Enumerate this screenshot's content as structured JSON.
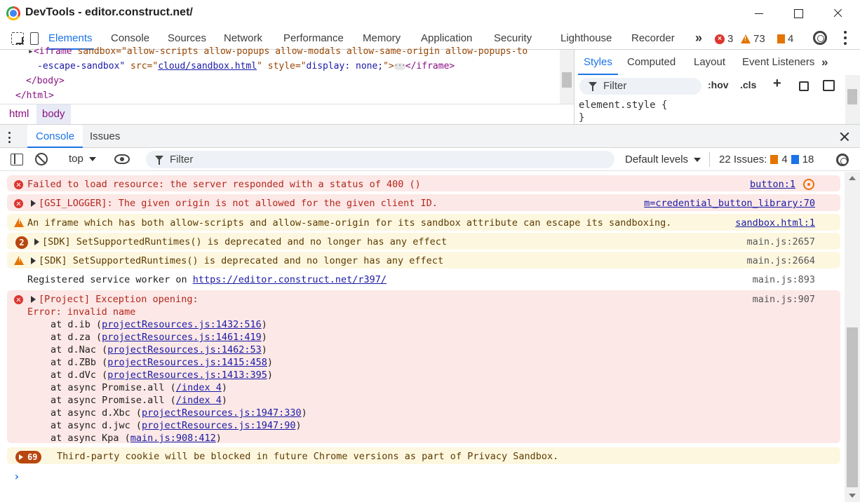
{
  "window": {
    "title": "DevTools - editor.construct.net/"
  },
  "main_tabs": [
    {
      "label": "Elements",
      "active": true
    },
    {
      "label": "Console"
    },
    {
      "label": "Sources"
    },
    {
      "label": "Network"
    },
    {
      "label": "Performance"
    },
    {
      "label": "Memory"
    },
    {
      "label": "Application"
    },
    {
      "label": "Security"
    },
    {
      "label": "Lighthouse"
    },
    {
      "label": "Recorder"
    }
  ],
  "status_counts": {
    "errors": "3",
    "warnings": "73",
    "info": "4"
  },
  "elements": {
    "line1": {
      "tag_open": "<iframe ",
      "attrs_text": "sandbox=\"allow-scripts allow-popups allow-modals allow-same-origin allow-popups-to"
    },
    "line2": {
      "part1": "-escape-sandbox\"",
      "src_attr": " src=\"",
      "src_link": "cloud/sandbox.html",
      "style_attr": "\" style=\"",
      "style_val": "display: none;",
      "close": "\">",
      "ellipsis": "···",
      "end_tag": "</iframe>"
    },
    "body_close": "</body>",
    "html_close": "</html>"
  },
  "breadcrumbs": [
    "html",
    "body"
  ],
  "styles": {
    "tabs": [
      "Styles",
      "Computed",
      "Layout",
      "Event Listeners"
    ],
    "filter_placeholder": "Filter",
    "hov": ":hov",
    "cls": ".cls",
    "rule": "element.style {",
    "rule_close": "}"
  },
  "drawer": {
    "tabs": [
      "Console",
      "Issues"
    ]
  },
  "console_toolbar": {
    "context": "top",
    "filter_placeholder": "Filter",
    "levels": "Default levels",
    "issues_label": "22 Issues:",
    "issues_info": "4",
    "issues_blue": "18"
  },
  "messages": [
    {
      "type": "error",
      "text": "Failed to load resource: the server responded with a status of 400 ()",
      "source": "button:1"
    },
    {
      "type": "error",
      "text": "[GSI_LOGGER]: The given origin is not allowed for the given client ID.",
      "source": "m=credential_button_library:70"
    },
    {
      "type": "warn",
      "text": "An iframe which has both allow-scripts and allow-same-origin for its sandbox attribute can escape its sandboxing.",
      "source": "sandbox.html:1"
    },
    {
      "type": "warn",
      "count": "2",
      "text": "[SDK] SetSupportedRuntimes() is deprecated and no longer has any effect",
      "source": "main.js:2657"
    },
    {
      "type": "warn",
      "text": "[SDK] SetSupportedRuntimes() is deprecated and no longer has any effect",
      "source": "main.js:2664"
    },
    {
      "type": "plain",
      "text_prefix": "Registered service worker on ",
      "link": "https://editor.construct.net/r397/",
      "source": "main.js:893"
    },
    {
      "type": "error",
      "text": "[Project] Exception opening:",
      "text2": "Error: invalid name",
      "source": "main.js:907"
    },
    {
      "type": "warn",
      "count": "69",
      "text": "Third-party cookie will be blocked in future Chrome versions as part of Privacy Sandbox."
    }
  ],
  "stack": [
    {
      "prefix": "at d.ib (",
      "link": "projectResources.js:1432:516",
      "suffix": ")"
    },
    {
      "prefix": "at d.za (",
      "link": "projectResources.js:1461:419",
      "suffix": ")"
    },
    {
      "prefix": "at d.Nac (",
      "link": "projectResources.js:1462:53",
      "suffix": ")"
    },
    {
      "prefix": "at d.ZBb (",
      "link": "projectResources.js:1415:458",
      "suffix": ")"
    },
    {
      "prefix": "at d.dVc (",
      "link": "projectResources.js:1413:395",
      "suffix": ")"
    },
    {
      "prefix": "at async Promise.all (",
      "link": "/index 4",
      "suffix": ")"
    },
    {
      "prefix": "at async Promise.all (",
      "link": "/index 4",
      "suffix": ")"
    },
    {
      "prefix": "at async d.Xbc (",
      "link": "projectResources.js:1947:330",
      "suffix": ")"
    },
    {
      "prefix": "at async d.jwc (",
      "link": "projectResources.js:1947:90",
      "suffix": ")"
    },
    {
      "prefix": "at async Kpa (",
      "link": "main.js:908:412",
      "suffix": ")"
    }
  ],
  "prompt": "›",
  "more_tabs": "»"
}
